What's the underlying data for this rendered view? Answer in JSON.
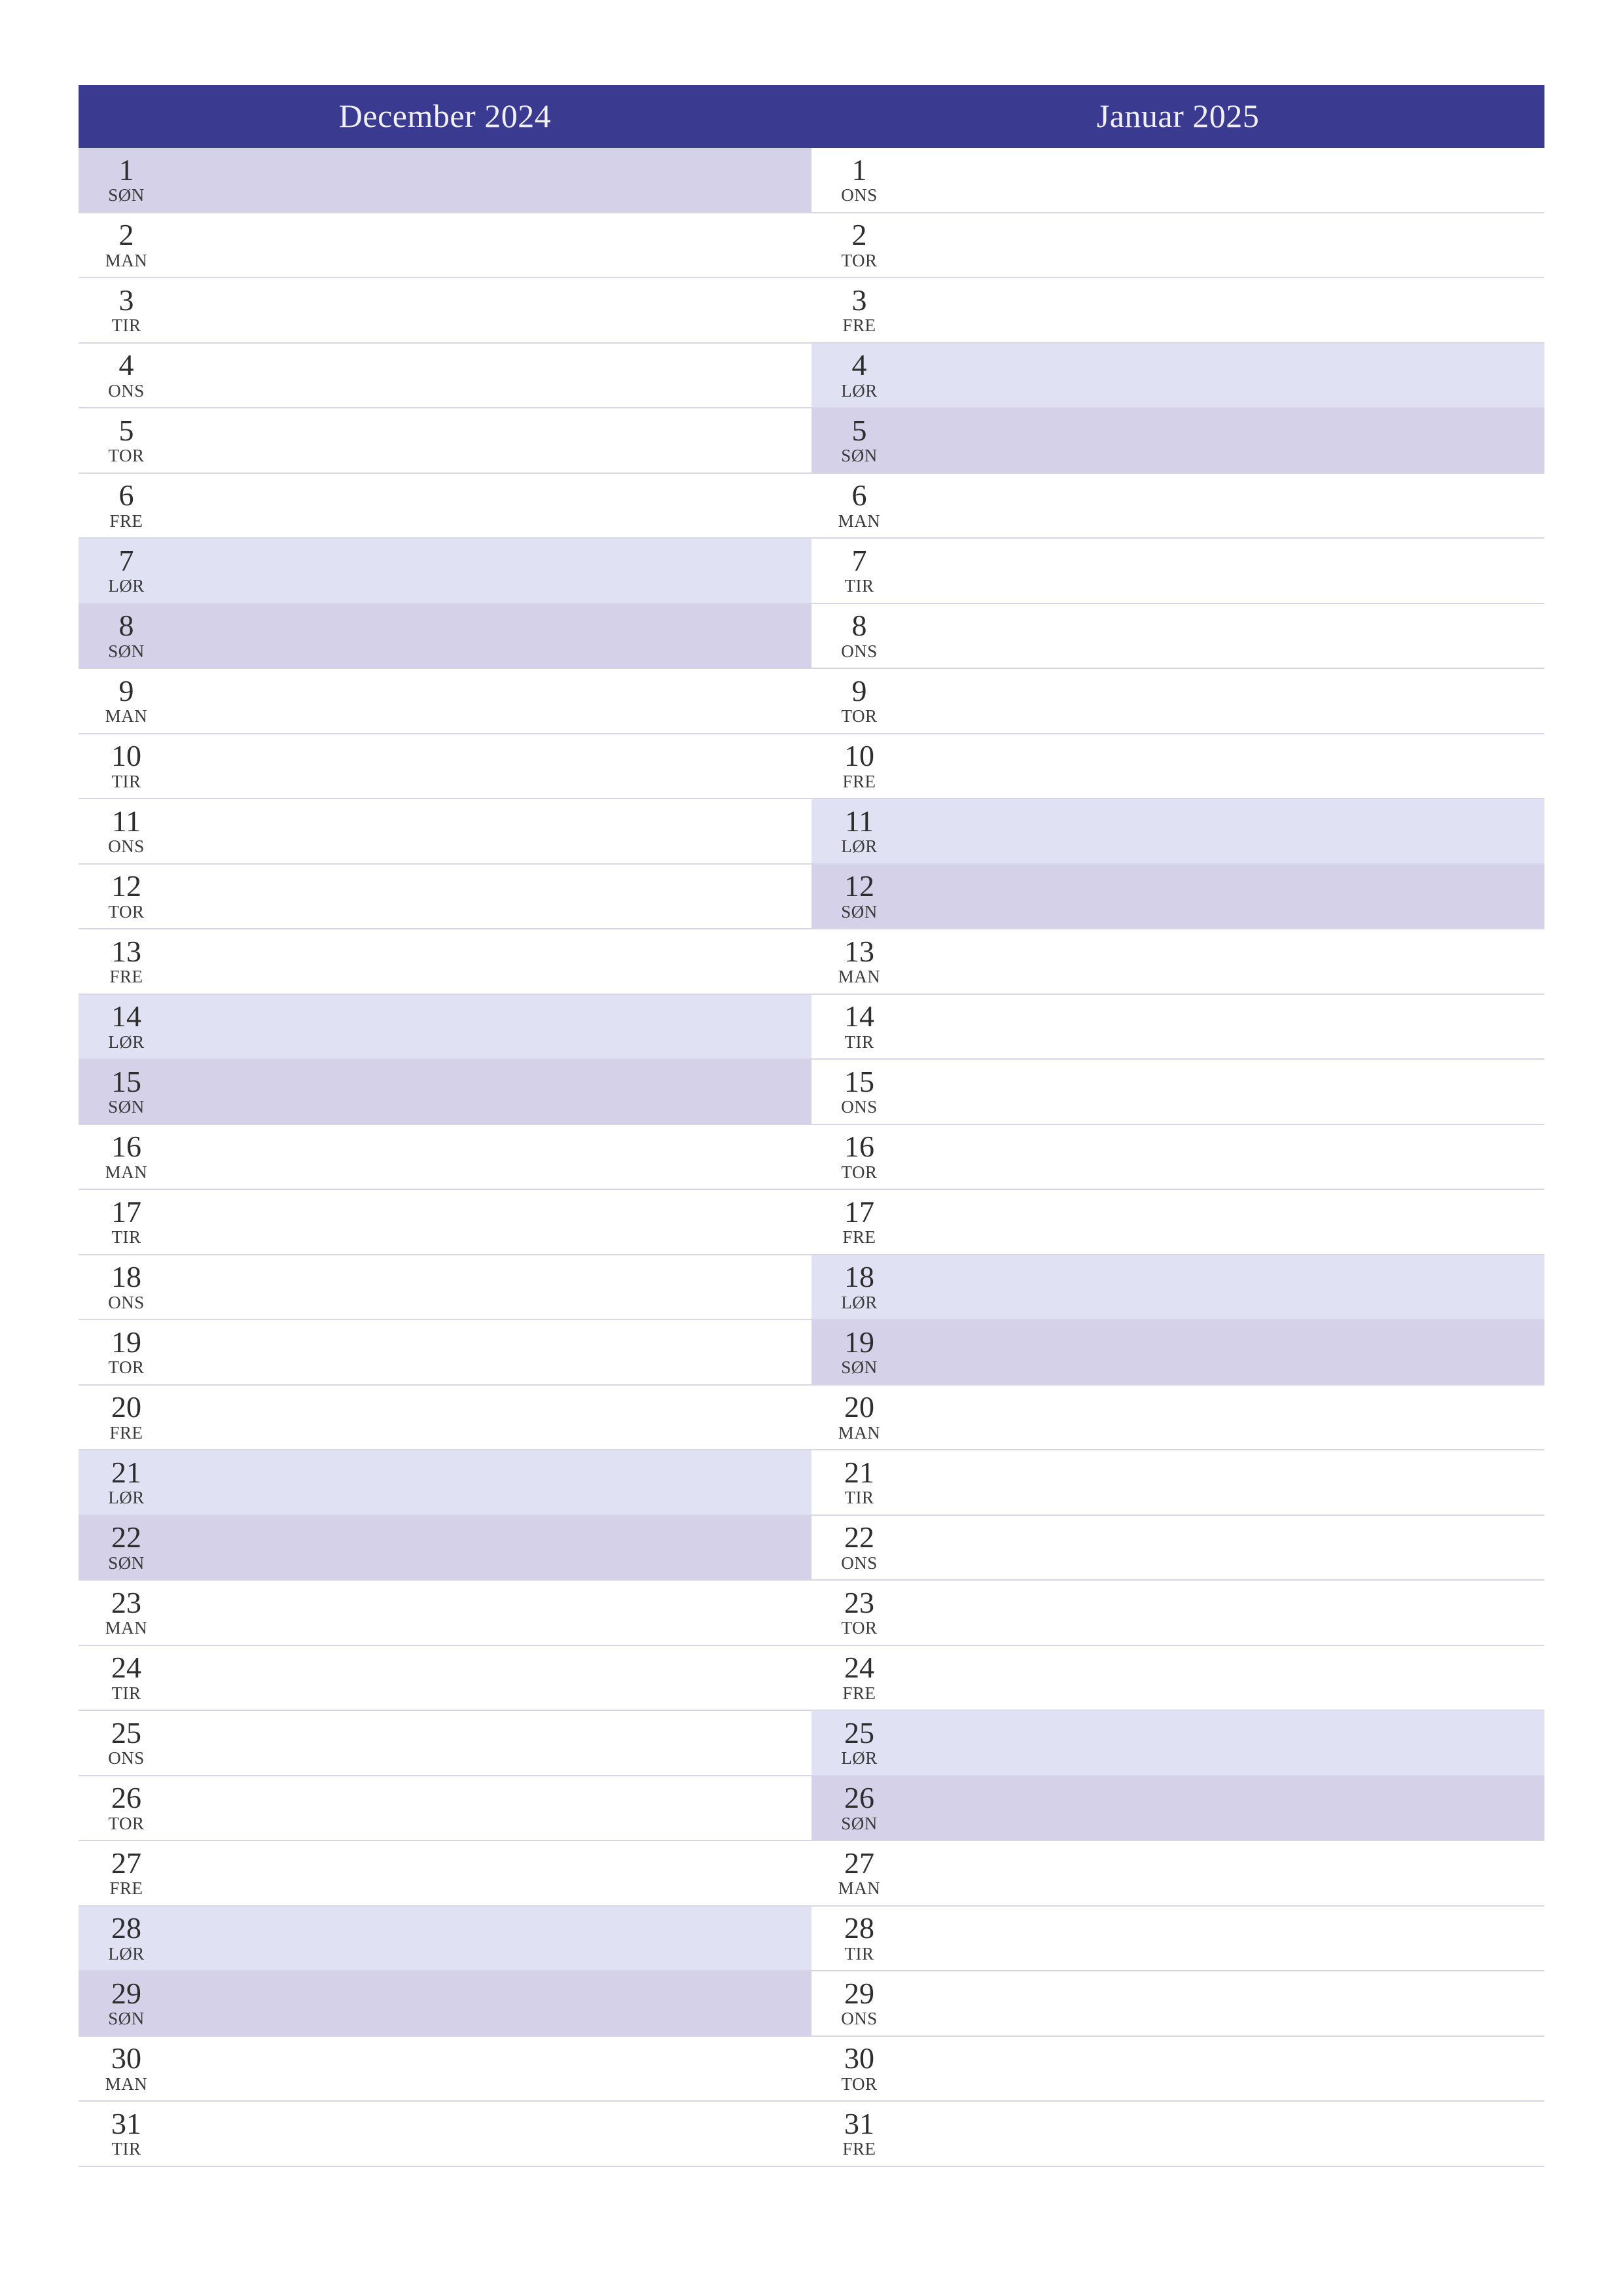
{
  "months": [
    {
      "title": "December 2024",
      "days": [
        {
          "num": "1",
          "abbr": "SØN",
          "type": "sun"
        },
        {
          "num": "2",
          "abbr": "MAN",
          "type": "weekday"
        },
        {
          "num": "3",
          "abbr": "TIR",
          "type": "weekday"
        },
        {
          "num": "4",
          "abbr": "ONS",
          "type": "weekday"
        },
        {
          "num": "5",
          "abbr": "TOR",
          "type": "weekday"
        },
        {
          "num": "6",
          "abbr": "FRE",
          "type": "weekday"
        },
        {
          "num": "7",
          "abbr": "LØR",
          "type": "sat"
        },
        {
          "num": "8",
          "abbr": "SØN",
          "type": "sun"
        },
        {
          "num": "9",
          "abbr": "MAN",
          "type": "weekday"
        },
        {
          "num": "10",
          "abbr": "TIR",
          "type": "weekday"
        },
        {
          "num": "11",
          "abbr": "ONS",
          "type": "weekday"
        },
        {
          "num": "12",
          "abbr": "TOR",
          "type": "weekday"
        },
        {
          "num": "13",
          "abbr": "FRE",
          "type": "weekday"
        },
        {
          "num": "14",
          "abbr": "LØR",
          "type": "sat"
        },
        {
          "num": "15",
          "abbr": "SØN",
          "type": "sun"
        },
        {
          "num": "16",
          "abbr": "MAN",
          "type": "weekday"
        },
        {
          "num": "17",
          "abbr": "TIR",
          "type": "weekday"
        },
        {
          "num": "18",
          "abbr": "ONS",
          "type": "weekday"
        },
        {
          "num": "19",
          "abbr": "TOR",
          "type": "weekday"
        },
        {
          "num": "20",
          "abbr": "FRE",
          "type": "weekday"
        },
        {
          "num": "21",
          "abbr": "LØR",
          "type": "sat"
        },
        {
          "num": "22",
          "abbr": "SØN",
          "type": "sun"
        },
        {
          "num": "23",
          "abbr": "MAN",
          "type": "weekday"
        },
        {
          "num": "24",
          "abbr": "TIR",
          "type": "weekday"
        },
        {
          "num": "25",
          "abbr": "ONS",
          "type": "weekday"
        },
        {
          "num": "26",
          "abbr": "TOR",
          "type": "weekday"
        },
        {
          "num": "27",
          "abbr": "FRE",
          "type": "weekday"
        },
        {
          "num": "28",
          "abbr": "LØR",
          "type": "sat"
        },
        {
          "num": "29",
          "abbr": "SØN",
          "type": "sun"
        },
        {
          "num": "30",
          "abbr": "MAN",
          "type": "weekday"
        },
        {
          "num": "31",
          "abbr": "TIR",
          "type": "weekday"
        }
      ]
    },
    {
      "title": "Januar 2025",
      "days": [
        {
          "num": "1",
          "abbr": "ONS",
          "type": "weekday"
        },
        {
          "num": "2",
          "abbr": "TOR",
          "type": "weekday"
        },
        {
          "num": "3",
          "abbr": "FRE",
          "type": "weekday"
        },
        {
          "num": "4",
          "abbr": "LØR",
          "type": "sat"
        },
        {
          "num": "5",
          "abbr": "SØN",
          "type": "sun"
        },
        {
          "num": "6",
          "abbr": "MAN",
          "type": "weekday"
        },
        {
          "num": "7",
          "abbr": "TIR",
          "type": "weekday"
        },
        {
          "num": "8",
          "abbr": "ONS",
          "type": "weekday"
        },
        {
          "num": "9",
          "abbr": "TOR",
          "type": "weekday"
        },
        {
          "num": "10",
          "abbr": "FRE",
          "type": "weekday"
        },
        {
          "num": "11",
          "abbr": "LØR",
          "type": "sat"
        },
        {
          "num": "12",
          "abbr": "SØN",
          "type": "sun"
        },
        {
          "num": "13",
          "abbr": "MAN",
          "type": "weekday"
        },
        {
          "num": "14",
          "abbr": "TIR",
          "type": "weekday"
        },
        {
          "num": "15",
          "abbr": "ONS",
          "type": "weekday"
        },
        {
          "num": "16",
          "abbr": "TOR",
          "type": "weekday"
        },
        {
          "num": "17",
          "abbr": "FRE",
          "type": "weekday"
        },
        {
          "num": "18",
          "abbr": "LØR",
          "type": "sat"
        },
        {
          "num": "19",
          "abbr": "SØN",
          "type": "sun"
        },
        {
          "num": "20",
          "abbr": "MAN",
          "type": "weekday"
        },
        {
          "num": "21",
          "abbr": "TIR",
          "type": "weekday"
        },
        {
          "num": "22",
          "abbr": "ONS",
          "type": "weekday"
        },
        {
          "num": "23",
          "abbr": "TOR",
          "type": "weekday"
        },
        {
          "num": "24",
          "abbr": "FRE",
          "type": "weekday"
        },
        {
          "num": "25",
          "abbr": "LØR",
          "type": "sat"
        },
        {
          "num": "26",
          "abbr": "SØN",
          "type": "sun"
        },
        {
          "num": "27",
          "abbr": "MAN",
          "type": "weekday"
        },
        {
          "num": "28",
          "abbr": "TIR",
          "type": "weekday"
        },
        {
          "num": "29",
          "abbr": "ONS",
          "type": "weekday"
        },
        {
          "num": "30",
          "abbr": "TOR",
          "type": "weekday"
        },
        {
          "num": "31",
          "abbr": "FRE",
          "type": "weekday"
        }
      ]
    }
  ]
}
